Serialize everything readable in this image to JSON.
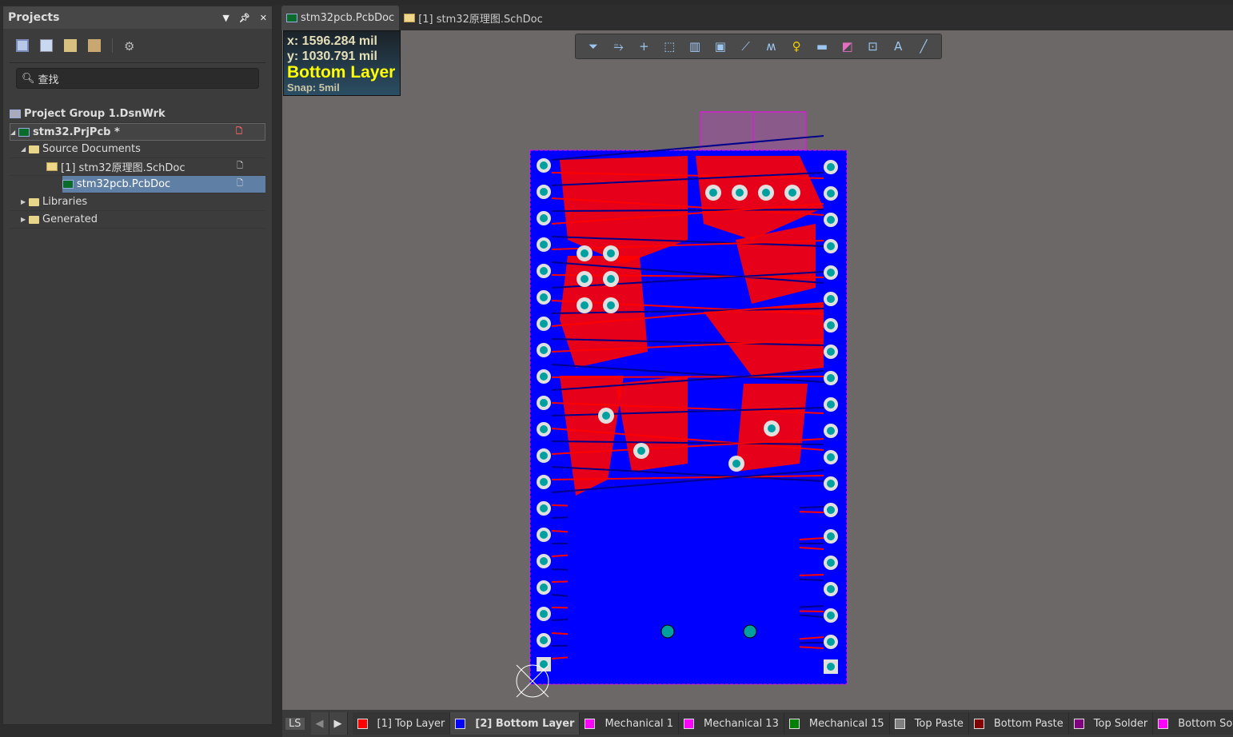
{
  "panel": {
    "title": "Projects",
    "search_placeholder": "查找",
    "tree": [
      {
        "label": "Project Group 1.DsnWrk",
        "icon": "project-group-icon"
      },
      {
        "label": "stm32.PrjPcb *",
        "icon": "pcb-project-icon"
      },
      {
        "label": "Source Documents",
        "icon": "folder-icon"
      },
      {
        "label": "[1] stm32原理图.SchDoc",
        "icon": "schematic-icon"
      },
      {
        "label": "stm32pcb.PcbDoc",
        "icon": "pcb-icon"
      },
      {
        "label": "Libraries",
        "icon": "folder-icon"
      },
      {
        "label": "Generated",
        "icon": "folder-icon"
      }
    ]
  },
  "tabs": [
    {
      "label": "stm32pcb.PcbDoc",
      "active": true
    },
    {
      "label": "[1] stm32原理图.SchDoc",
      "active": false
    }
  ],
  "hud": {
    "x": "x:  1596.284 mil",
    "y": "y:  1030.791 mil",
    "layer": "Bottom Layer",
    "snap": "Snap: 5mil"
  },
  "toolbar": [
    "filter-icon",
    "route-icon",
    "cross-icon",
    "select-rect-icon",
    "align-icon",
    "component-icon",
    "interactive-route-icon",
    "diff-pair-icon",
    "via-icon",
    "fill-icon",
    "region-icon",
    "dimension-icon",
    "text-icon",
    "line-icon"
  ],
  "toolbar_glyphs": [
    "⏷",
    "⥱",
    "+",
    "⬚",
    "▥",
    "▣",
    "⟋",
    "ʍ",
    "♀",
    "▬",
    "◩",
    "⊡",
    "A",
    "╱"
  ],
  "colors": {
    "board": "#0000ff",
    "top_layer": "#ff0000",
    "pad": "#00a0a0",
    "canvas": "#6d6868"
  },
  "layers": {
    "current_swatch": "#0000ff",
    "ls_label": "LS",
    "items": [
      {
        "label": "[1] Top Layer",
        "color": "#ff0000"
      },
      {
        "label": "[2] Bottom Layer",
        "color": "#0000ff",
        "active": true
      },
      {
        "label": "Mechanical 1",
        "color": "#ff00ff"
      },
      {
        "label": "Mechanical 13",
        "color": "#ff00ff"
      },
      {
        "label": "Mechanical 15",
        "color": "#008000"
      },
      {
        "label": "Top Paste",
        "color": "#808080"
      },
      {
        "label": "Bottom Paste",
        "color": "#800000"
      },
      {
        "label": "Top Solder",
        "color": "#800080"
      },
      {
        "label": "Bottom Solder",
        "color": "#ff00ff"
      }
    ]
  }
}
